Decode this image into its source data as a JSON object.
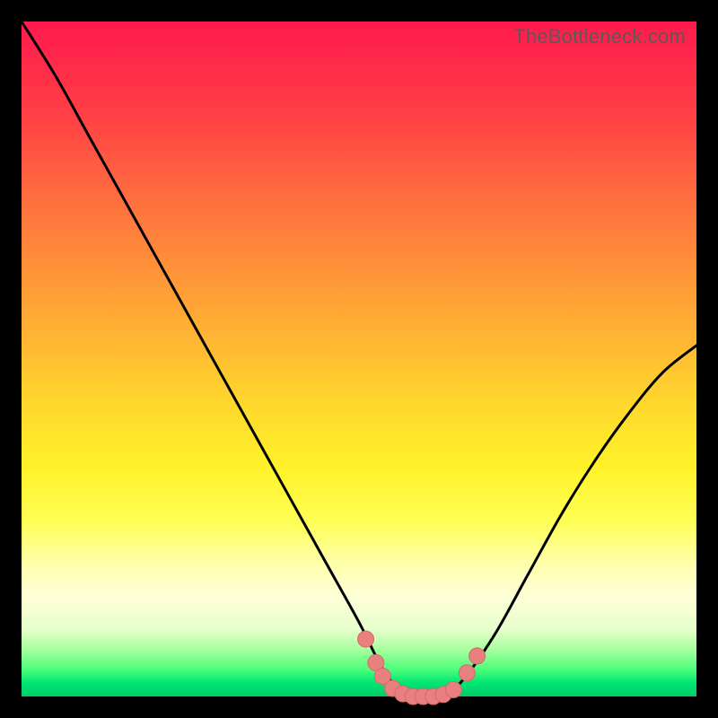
{
  "attribution": "TheBottleneck.com",
  "colors": {
    "curve": "#000000",
    "marker_fill": "#e98080",
    "marker_stroke": "#d46a6a"
  },
  "chart_data": {
    "type": "line",
    "title": "",
    "xlabel": "",
    "ylabel": "",
    "xlim": [
      0,
      100
    ],
    "ylim": [
      0,
      100
    ],
    "annotations": [
      "TheBottleneck.com"
    ],
    "series": [
      {
        "name": "bottleneck-curve",
        "x": [
          0,
          5,
          10,
          15,
          20,
          25,
          30,
          35,
          40,
          45,
          50,
          53,
          55,
          58,
          60,
          62,
          65,
          70,
          75,
          80,
          85,
          90,
          95,
          100
        ],
        "values": [
          100,
          92,
          83,
          74,
          65,
          56,
          47,
          38,
          29,
          20,
          11,
          5,
          2,
          0,
          0,
          0,
          2,
          9,
          18,
          27,
          35,
          42,
          48,
          52
        ]
      }
    ],
    "markers": [
      {
        "x": 51.0,
        "y": 8.5
      },
      {
        "x": 52.5,
        "y": 5.0
      },
      {
        "x": 53.5,
        "y": 3.0
      },
      {
        "x": 55.0,
        "y": 1.2
      },
      {
        "x": 56.5,
        "y": 0.4
      },
      {
        "x": 58.0,
        "y": 0.0
      },
      {
        "x": 59.5,
        "y": 0.0
      },
      {
        "x": 61.0,
        "y": 0.0
      },
      {
        "x": 62.5,
        "y": 0.3
      },
      {
        "x": 64.0,
        "y": 1.0
      },
      {
        "x": 66.0,
        "y": 3.5
      },
      {
        "x": 67.5,
        "y": 6.0
      }
    ]
  }
}
